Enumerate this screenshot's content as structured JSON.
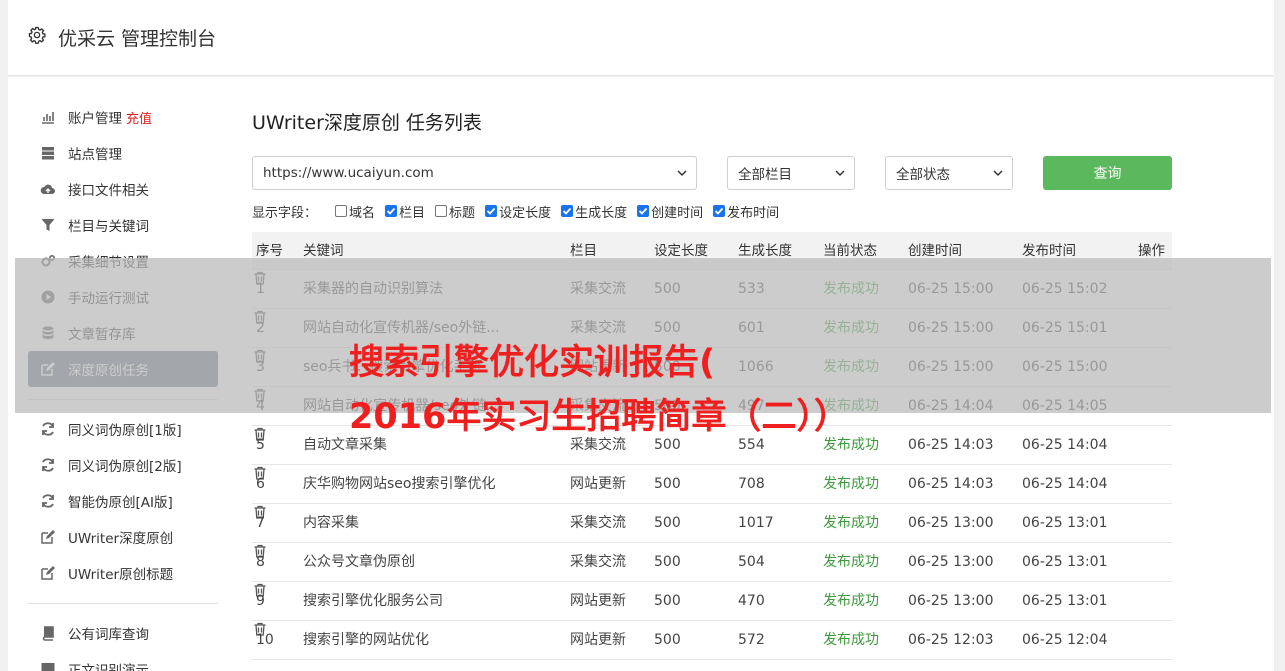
{
  "header": {
    "title": "优采云 管理控制台"
  },
  "sidebar": {
    "groups": [
      [
        {
          "label": "账户管理",
          "icon": "bar-chart-icon",
          "extra": "充值"
        },
        {
          "label": "站点管理",
          "icon": "server-icon"
        },
        {
          "label": "接口文件相关",
          "icon": "cloud-upload-icon"
        },
        {
          "label": "栏目与关键词",
          "icon": "filter-icon"
        },
        {
          "label": "采集细节设置",
          "icon": "gears-icon"
        },
        {
          "label": "手动运行测试",
          "icon": "play-circle-icon"
        },
        {
          "label": "文章暂存库",
          "icon": "database-icon"
        },
        {
          "label": "深度原创任务",
          "icon": "edit-icon",
          "active": true
        }
      ],
      [
        {
          "label": "同义词伪原创[1版]",
          "icon": "refresh-icon"
        },
        {
          "label": "同义词伪原创[2版]",
          "icon": "refresh-icon"
        },
        {
          "label": "智能伪原创[AI版]",
          "icon": "refresh-icon"
        },
        {
          "label": "UWriter深度原创",
          "icon": "edit-icon"
        },
        {
          "label": "UWriter原创标题",
          "icon": "edit-icon"
        }
      ],
      [
        {
          "label": "公有词库查询",
          "icon": "book-icon"
        },
        {
          "label": "正文识别演示",
          "icon": "monitor-icon"
        }
      ]
    ]
  },
  "main": {
    "title": "UWriter深度原创 任务列表",
    "filters": {
      "site": "https://www.ucaiyun.com",
      "column": "全部栏目",
      "status": "全部状态",
      "query_label": "查询"
    },
    "fields": {
      "label": "显示字段：",
      "items": [
        {
          "label": "域名",
          "checked": false
        },
        {
          "label": "栏目",
          "checked": true
        },
        {
          "label": "标题",
          "checked": false
        },
        {
          "label": "设定长度",
          "checked": true
        },
        {
          "label": "生成长度",
          "checked": true
        },
        {
          "label": "创建时间",
          "checked": true
        },
        {
          "label": "发布时间",
          "checked": true
        }
      ]
    },
    "table": {
      "headers": [
        "序号",
        "关键词",
        "栏目",
        "设定长度",
        "生成长度",
        "当前状态",
        "创建时间",
        "发布时间",
        "操作"
      ],
      "rows": [
        [
          "1",
          "采集器的自动识别算法",
          "采集交流",
          "500",
          "533",
          "发布成功",
          "06-25 15:00",
          "06-25 15:02"
        ],
        [
          "2",
          "网站自动化宣传机器/seo外链...",
          "采集交流",
          "500",
          "601",
          "发布成功",
          "06-25 15:00",
          "06-25 15:01"
        ],
        [
          "3",
          "seo兵书：搜索引擎优化手册",
          "网站更新",
          "500",
          "1066",
          "发布成功",
          "06-25 15:00",
          "06-25 15:00"
        ],
        [
          "4",
          "网站自动化宣传机器/seo外链...",
          "采集交流",
          "500",
          "497",
          "发布成功",
          "06-25 14:04",
          "06-25 14:05"
        ],
        [
          "5",
          "自动文章采集",
          "采集交流",
          "500",
          "554",
          "发布成功",
          "06-25 14:03",
          "06-25 14:04"
        ],
        [
          "6",
          "庆华购物网站seo搜索引擎优化",
          "网站更新",
          "500",
          "708",
          "发布成功",
          "06-25 14:03",
          "06-25 14:04"
        ],
        [
          "7",
          "内容采集",
          "采集交流",
          "500",
          "1017",
          "发布成功",
          "06-25 13:00",
          "06-25 13:01"
        ],
        [
          "8",
          "公众号文章伪原创",
          "采集交流",
          "500",
          "504",
          "发布成功",
          "06-25 13:00",
          "06-25 13:01"
        ],
        [
          "9",
          "搜索引擎优化服务公司",
          "网站更新",
          "500",
          "470",
          "发布成功",
          "06-25 13:00",
          "06-25 13:01"
        ],
        [
          "10",
          "搜索引擎的网站优化",
          "网站更新",
          "500",
          "572",
          "发布成功",
          "06-25 12:03",
          "06-25 12:04"
        ]
      ]
    }
  },
  "overlay": {
    "line1": "搜索引擎优化实训报告(",
    "line2": "2016年实习生招聘简章（二））"
  },
  "colors": {
    "accent_green": "#5cb85c",
    "active_nav": "#6c7686",
    "overlay_red": "#ef1f1f",
    "status_green": "#3c9a3c"
  }
}
